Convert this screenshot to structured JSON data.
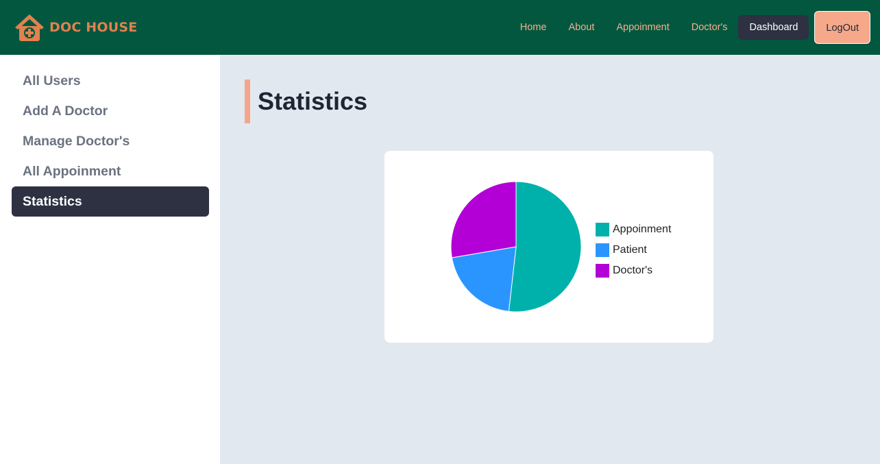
{
  "brand": {
    "name": "DOC HOUSE",
    "logo_icon": "house-plus-icon"
  },
  "nav": {
    "links": [
      "Home",
      "About",
      "Appoinment",
      "Doctor's"
    ],
    "dashboard_label": "Dashboard",
    "logout_label": "LogOut"
  },
  "sidebar": {
    "items": [
      {
        "label": "All Users"
      },
      {
        "label": "Add A Doctor"
      },
      {
        "label": "Manage Doctor's"
      },
      {
        "label": "All Appoinment"
      },
      {
        "label": "Statistics",
        "active": true
      }
    ]
  },
  "main": {
    "title": "Statistics"
  },
  "colors": {
    "header_bg": "#03573f",
    "accent": "#f4a58a",
    "active_item": "#2d3142"
  },
  "chart_data": {
    "type": "pie",
    "title": "",
    "legend_position": "right",
    "series": [
      {
        "name": "Appoinment",
        "value": 51.8,
        "color": "#00b1ab"
      },
      {
        "name": "Patient",
        "value": 20.5,
        "color": "#2b95ff"
      },
      {
        "name": "Doctor's",
        "value": 27.7,
        "color": "#b300d7"
      }
    ]
  }
}
